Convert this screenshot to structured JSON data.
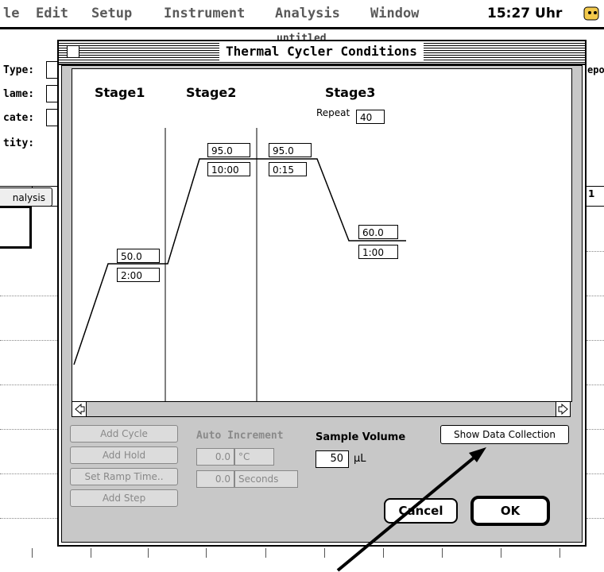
{
  "menubar": {
    "items": [
      "le",
      "Edit",
      "Setup",
      "Instrument",
      "Analysis",
      "Window"
    ],
    "clock": "15:27 Uhr"
  },
  "background_window": {
    "title": "untitled",
    "labels": [
      "Type:",
      "lame:",
      "cate:",
      "tity:"
    ],
    "analysis_button": "nalysis",
    "right_label": "epo",
    "column_header": "1"
  },
  "dialog": {
    "title": "Thermal Cycler Conditions",
    "stages": [
      "Stage1",
      "Stage2",
      "Stage3"
    ],
    "repeat_label": "Repeat",
    "repeat_value": "40",
    "steps": [
      {
        "temp": "50.0",
        "time": "2:00"
      },
      {
        "temp": "95.0",
        "time": "10:00"
      },
      {
        "temp": "95.0",
        "time": "0:15"
      },
      {
        "temp": "60.0",
        "time": "1:00"
      }
    ],
    "buttons": {
      "add_cycle": "Add Cycle",
      "add_hold": "Add Hold",
      "set_ramp_time": "Set Ramp Time..",
      "add_step": "Add Step",
      "show_data_collection": "Show Data Collection",
      "cancel": "Cancel",
      "ok": "OK"
    },
    "auto_increment": {
      "label": "Auto Increment",
      "temp_value": "0.0",
      "temp_unit": "°C",
      "time_value": "0.0",
      "time_unit": "Seconds"
    },
    "sample_volume": {
      "label": "Sample Volume",
      "value": "50",
      "unit": "µL"
    }
  }
}
